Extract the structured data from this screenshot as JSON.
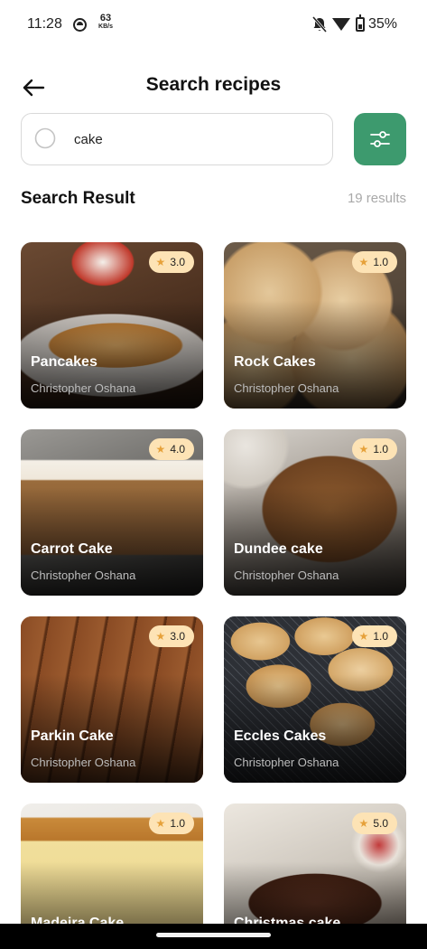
{
  "status_bar": {
    "time": "11:28",
    "speed_value": "63",
    "speed_unit": "KB/s",
    "battery": "35%"
  },
  "header": {
    "title": "Search recipes",
    "back_icon": "arrow-left-icon"
  },
  "search": {
    "value": "cake",
    "icon": "search-icon",
    "filter_icon": "sliders-icon"
  },
  "results": {
    "title": "Search Result",
    "count": "19 results"
  },
  "colors": {
    "accent": "#3d9a6e",
    "badge": "#fde3b5",
    "star": "#e6a13a"
  },
  "recipes": [
    {
      "name": "Pancakes",
      "author": "Christopher Oshana",
      "rating": "3.0"
    },
    {
      "name": "Rock Cakes",
      "author": "Christopher Oshana",
      "rating": "1.0"
    },
    {
      "name": "Carrot Cake",
      "author": "Christopher Oshana",
      "rating": "4.0"
    },
    {
      "name": "Dundee cake",
      "author": "Christopher Oshana",
      "rating": "1.0"
    },
    {
      "name": "Parkin Cake",
      "author": "Christopher Oshana",
      "rating": "3.0"
    },
    {
      "name": "Eccles Cakes",
      "author": "Christopher Oshana",
      "rating": "1.0"
    },
    {
      "name": "Madeira Cake",
      "author": "",
      "rating": "1.0"
    },
    {
      "name": "Christmas cake",
      "author": "",
      "rating": "5.0"
    }
  ]
}
